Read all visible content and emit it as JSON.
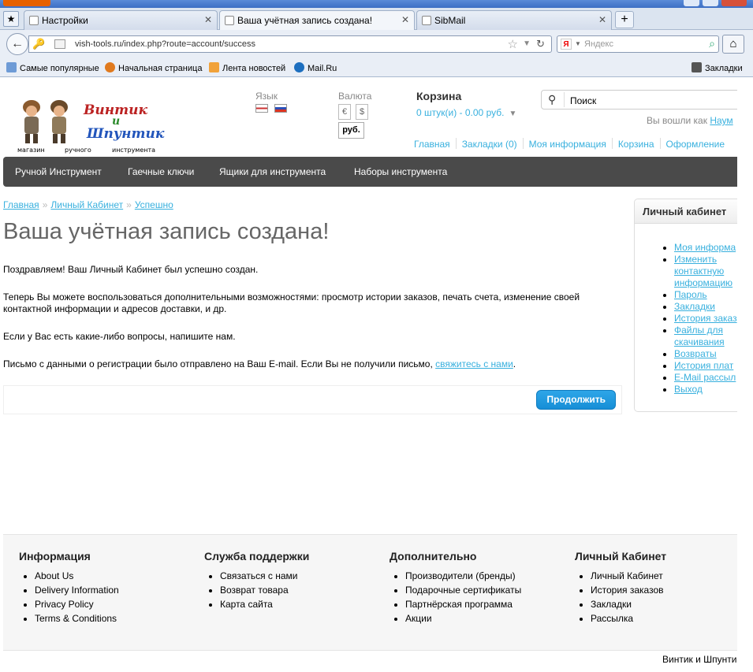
{
  "browser": {
    "tabs": [
      {
        "title": "Настройки"
      },
      {
        "title": "Ваша учётная запись создана!"
      },
      {
        "title": "SibMail"
      }
    ],
    "url": "vish-tools.ru/index.php?route=account/success",
    "search_placeholder": "Яндекс",
    "bookmarks": [
      "Самые популярные",
      "Начальная страница",
      "Лента новостей",
      "Mail.Ru"
    ],
    "bookmarks_menu": "Закладки"
  },
  "header": {
    "logo": {
      "words": [
        "Винтик",
        "и",
        "Шпунтик"
      ],
      "tagline": [
        "магазин",
        "ручного",
        "инструмента"
      ]
    },
    "language_label": "Язык",
    "currency_label": "Валюта",
    "currencies": [
      "€",
      "$",
      "руб."
    ],
    "cart_title": "Корзина",
    "cart_info": "0 штук(и) - 0.00 руб.",
    "search_value": "Поиск",
    "logged_prefix": "Вы вошли как",
    "logged_user": "Наум",
    "toplinks": [
      "Главная",
      "Закладки (0)",
      "Моя информация",
      "Корзина",
      "Оформление"
    ]
  },
  "menu": [
    "Ручной Инструмент",
    "Гаечные ключи",
    "Ящики для инструмента",
    "Наборы инструмента"
  ],
  "breadcrumb": [
    "Главная",
    "Личный Кабинет",
    "Успешно"
  ],
  "main": {
    "title": "Ваша учётная запись создана!",
    "p1": "Поздравляем! Ваш Личный Кабинет был успешно создан.",
    "p2": "Теперь Вы можете воспользоваться дополнительными возможностями: просмотр истории заказов, печать счета, изменение своей контактной информации и адресов доставки, и др.",
    "p3": "Если у Вас есть какие-либо вопросы, напишите нам.",
    "p4_text": "Письмо с данными о регистрации было отправлено на Ваш E-mail. Если Вы не получили письмо, ",
    "p4_link": "свяжитесь с нами",
    "continue": "Продолжить"
  },
  "sidebar": {
    "title": "Личный кабинет",
    "items": [
      "Моя информа",
      "Изменить\nконтактную\nинформацию",
      "Пароль",
      "Закладки",
      "История заказ",
      "Файлы для\nскачивания",
      "Возвраты",
      "История плат",
      "E-Mail рассыл",
      "Выход"
    ]
  },
  "footer": {
    "cols": [
      {
        "title": "Информация",
        "items": [
          "About Us",
          "Delivery Information",
          "Privacy Policy",
          "Terms & Conditions"
        ]
      },
      {
        "title": "Служба поддержки",
        "items": [
          "Связаться с нами",
          "Возврат товара",
          "Карта сайта"
        ]
      },
      {
        "title": "Дополнительно",
        "items": [
          "Производители (бренды)",
          "Подарочные сертификаты",
          "Партнёрская программа",
          "Акции"
        ]
      },
      {
        "title": "Личный Кабинет",
        "items": [
          "Личный Кабинет",
          "История заказов",
          "Закладки",
          "Рассылка"
        ]
      }
    ],
    "powered": "Винтик и Шпунти"
  },
  "colors": {
    "link": "#38b0de",
    "menu_bg": "#4a4a4a",
    "button": "#1a96dc"
  }
}
